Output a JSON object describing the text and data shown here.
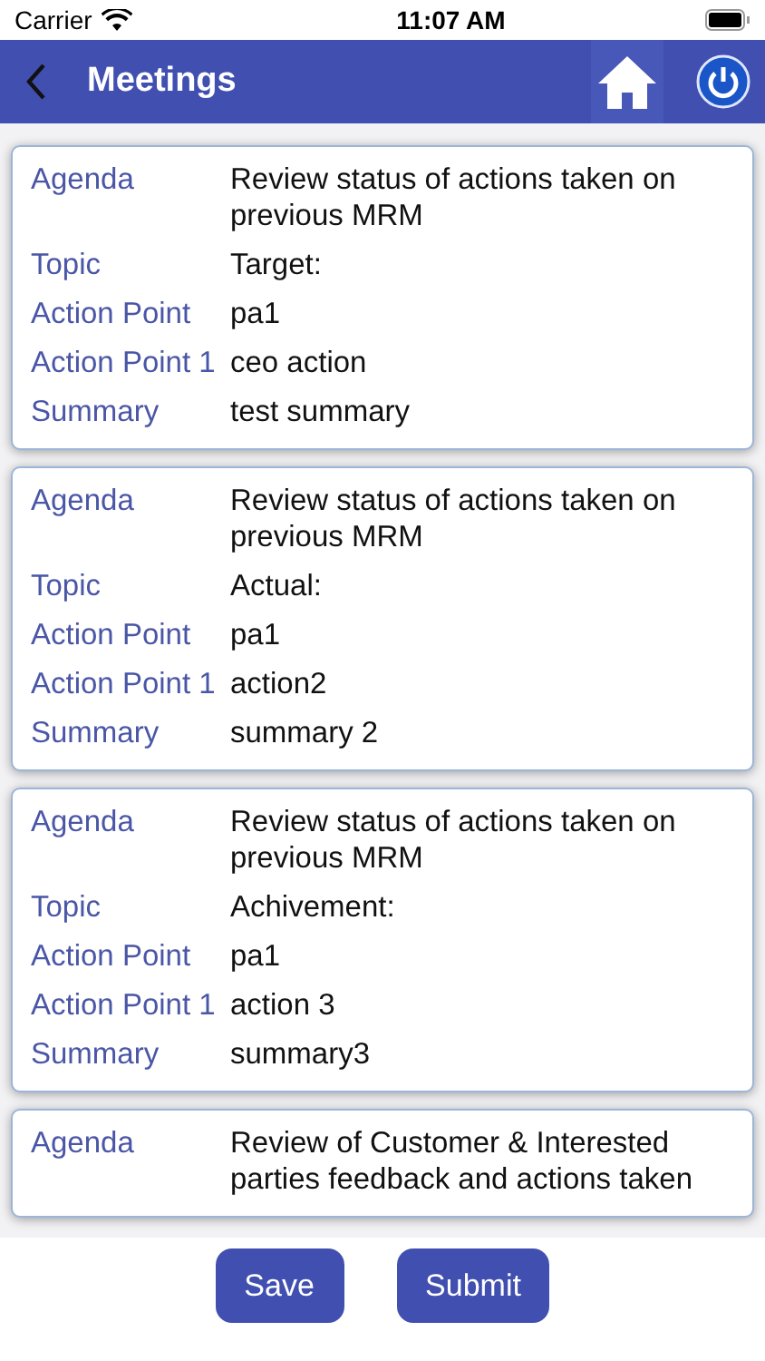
{
  "status_bar": {
    "carrier": "Carrier",
    "time": "11:07 AM"
  },
  "nav": {
    "title": "Meetings"
  },
  "meetings": [
    {
      "fields": [
        {
          "label": "Agenda",
          "value": "Review status of actions taken on previous MRM"
        },
        {
          "label": "Topic",
          "value": "Target:"
        },
        {
          "label": "Action Point",
          "value": "pa1"
        },
        {
          "label": "Action Point 1",
          "value": "ceo action"
        },
        {
          "label": "Summary",
          "value": "test summary"
        }
      ]
    },
    {
      "fields": [
        {
          "label": "Agenda",
          "value": "Review status of actions taken on previous MRM"
        },
        {
          "label": "Topic",
          "value": "Actual:"
        },
        {
          "label": "Action Point",
          "value": "pa1"
        },
        {
          "label": "Action Point 1",
          "value": "action2"
        },
        {
          "label": "Summary",
          "value": "summary 2"
        }
      ]
    },
    {
      "fields": [
        {
          "label": "Agenda",
          "value": "Review status of actions taken on previous MRM"
        },
        {
          "label": "Topic",
          "value": "Achivement:"
        },
        {
          "label": "Action Point",
          "value": "pa1"
        },
        {
          "label": "Action Point 1",
          "value": "action 3"
        },
        {
          "label": "Summary",
          "value": "summary3"
        }
      ]
    },
    {
      "fields": [
        {
          "label": "Agenda",
          "value": "Review of Customer & Interested parties feedback and actions taken"
        }
      ]
    }
  ],
  "buttons": [
    "Save",
    "Submit"
  ]
}
